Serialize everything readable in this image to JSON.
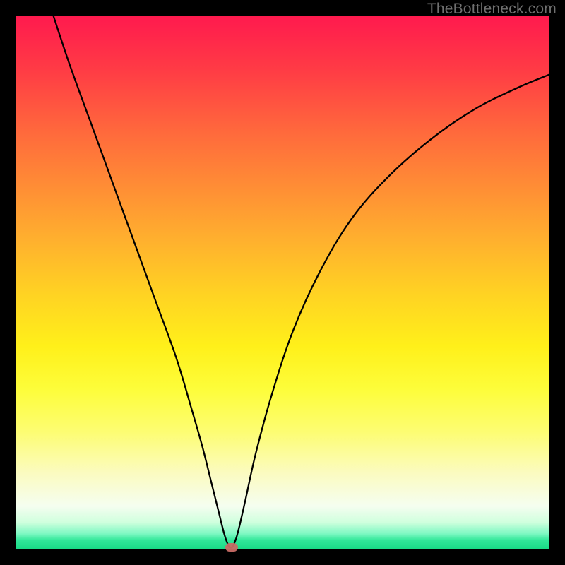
{
  "watermark": "TheBottleneck.com",
  "chart_data": {
    "type": "line",
    "title": "",
    "xlabel": "",
    "ylabel": "",
    "xlim": [
      0,
      100
    ],
    "ylim": [
      0,
      100
    ],
    "grid": false,
    "series": [
      {
        "name": "bottleneck-curve",
        "x": [
          7,
          10,
          14,
          18,
          22,
          26,
          30,
          33,
          35,
          36.5,
          38,
          39,
          39.8,
          40.3,
          40.8,
          41.6,
          43,
          45,
          48,
          52,
          57,
          63,
          70,
          78,
          86,
          94,
          100
        ],
        "y": [
          100,
          91,
          80,
          69,
          58,
          47,
          36,
          26,
          19,
          13,
          7,
          3,
          0.7,
          0.2,
          0.7,
          3,
          9,
          18,
          29,
          41,
          52,
          62,
          70,
          77,
          82.5,
          86.5,
          89
        ]
      }
    ],
    "marker": {
      "x": 40.5,
      "y": 0.3
    },
    "gradient_stops": [
      {
        "pos": 0,
        "color": "#ff1a4e"
      },
      {
        "pos": 0.5,
        "color": "#ffd223"
      },
      {
        "pos": 0.78,
        "color": "#fdfd72"
      },
      {
        "pos": 1.0,
        "color": "#19db86"
      }
    ]
  }
}
